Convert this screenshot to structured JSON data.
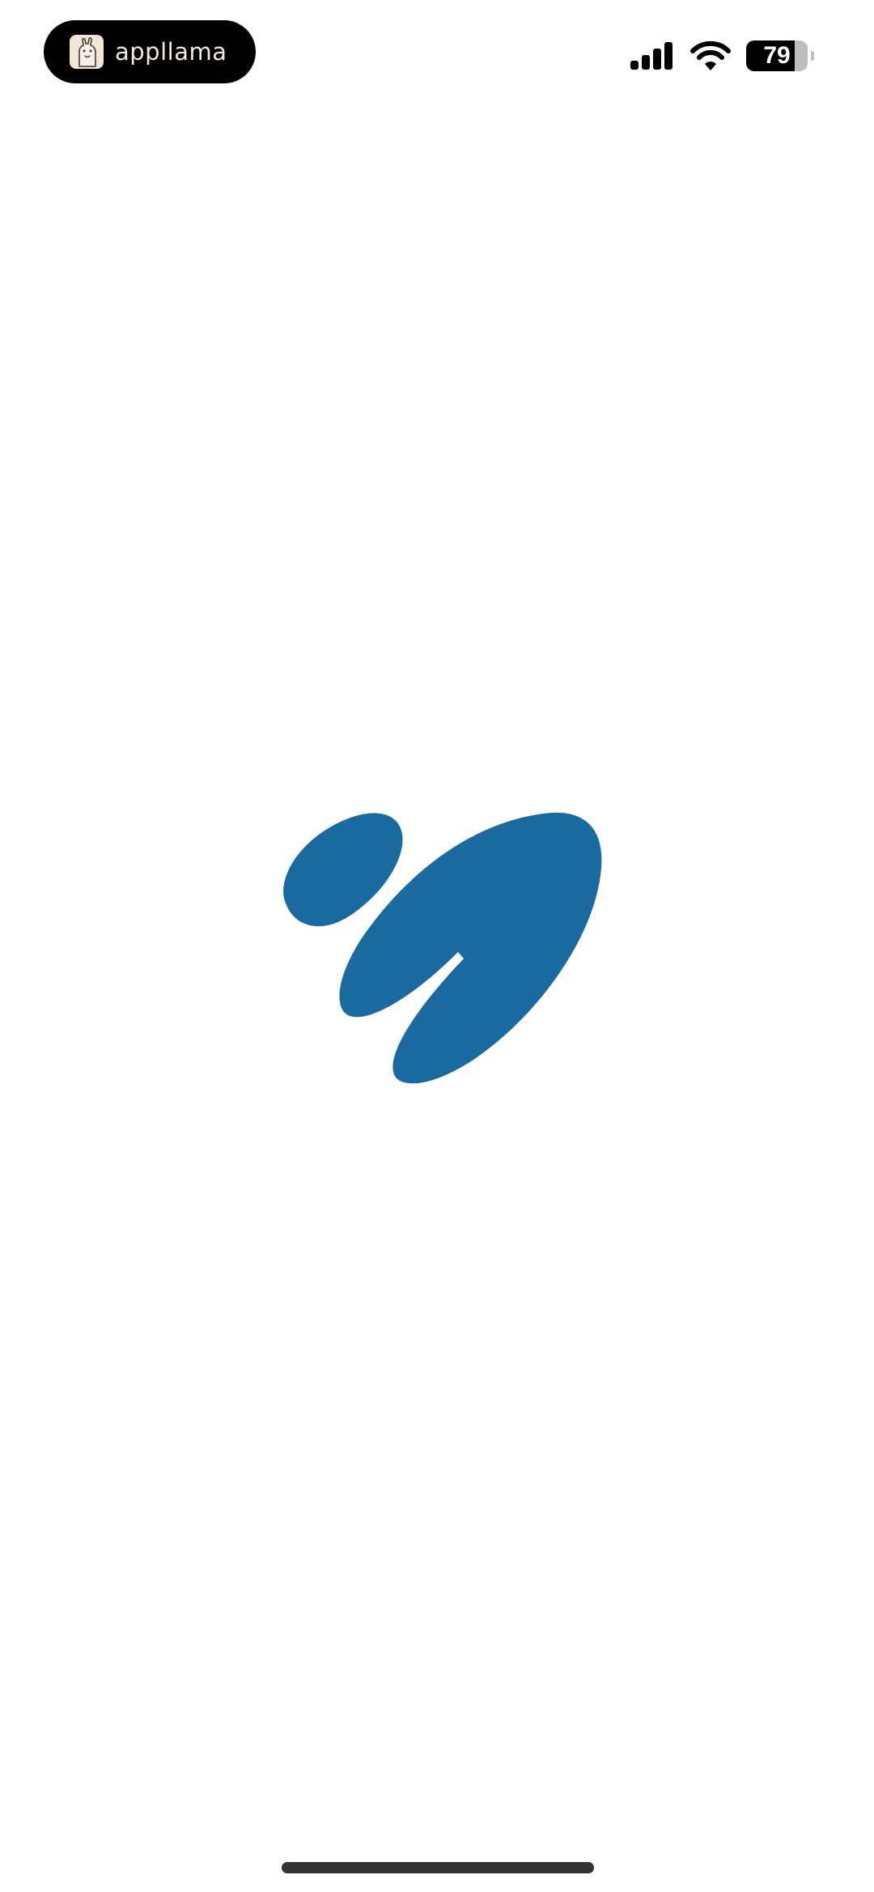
{
  "status_bar": {
    "app_pill": {
      "label": "appllama",
      "icon": "llama-icon"
    },
    "battery": {
      "level": 79,
      "label": "79"
    },
    "icons": [
      "signal-icon",
      "wifi-icon",
      "battery-icon"
    ]
  },
  "splash": {
    "logo": "blue-abstract-logo-icon"
  },
  "colors": {
    "logo_blue": "#1a6aa0",
    "background": "#ffffff",
    "pill_background": "#000000",
    "home_indicator": "#333333"
  }
}
